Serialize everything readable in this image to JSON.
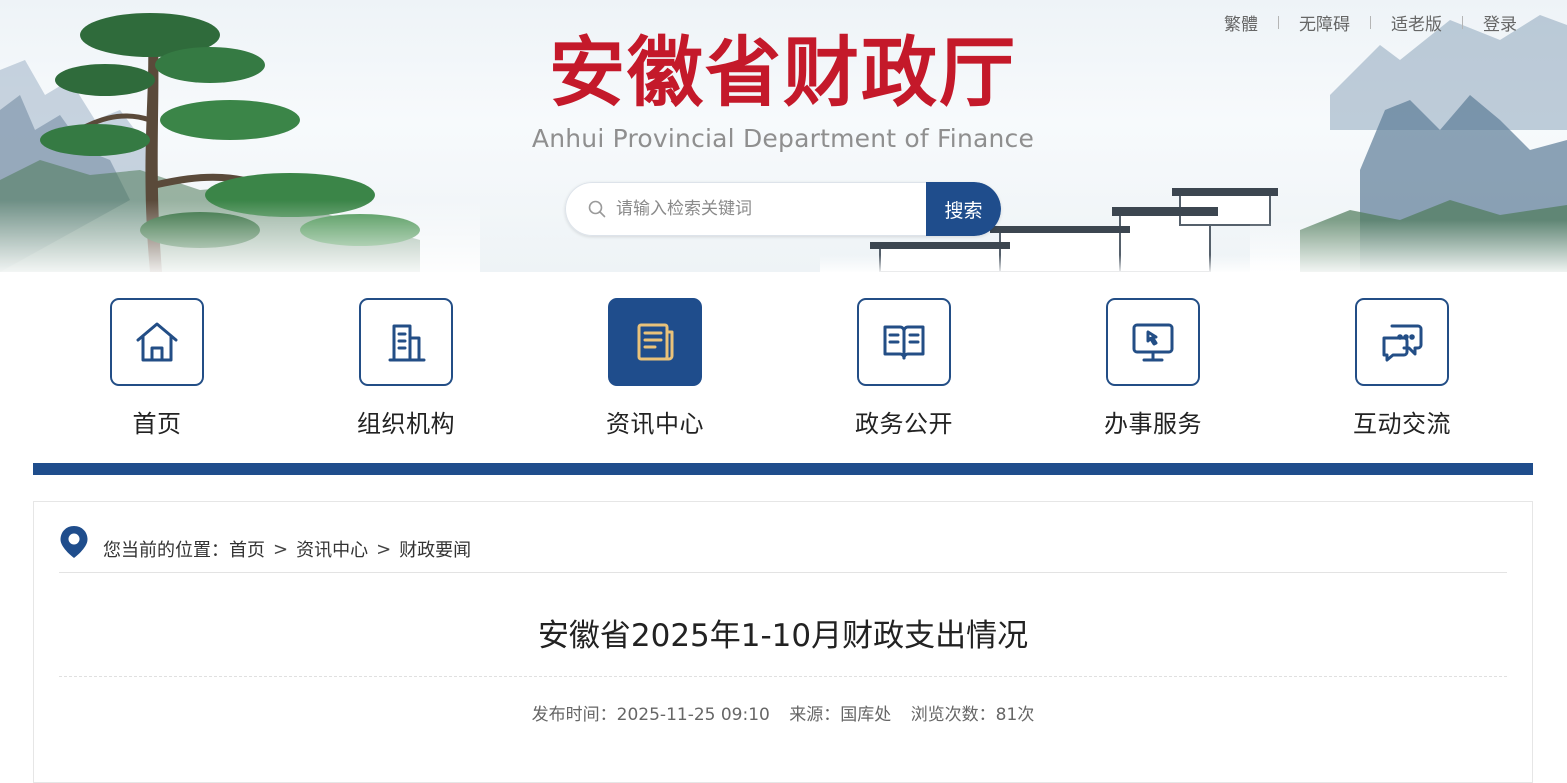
{
  "header": {
    "top_links": [
      "繁體",
      "无障碍",
      "适老版",
      "登录"
    ],
    "site_title": "安徽省财政厅",
    "site_subtitle": "Anhui Provincial Department of Finance",
    "search": {
      "placeholder": "请输入检索关键词",
      "value": "",
      "button_label": "搜索"
    }
  },
  "nav": {
    "items": [
      {
        "label": "首页",
        "icon": "home-icon"
      },
      {
        "label": "组织机构",
        "icon": "building-icon"
      },
      {
        "label": "资讯中心",
        "icon": "news-icon",
        "active": true
      },
      {
        "label": "政务公开",
        "icon": "open-book-icon"
      },
      {
        "label": "办事服务",
        "icon": "monitor-cursor-icon"
      },
      {
        "label": "互动交流",
        "icon": "chat-bubbles-icon"
      }
    ]
  },
  "breadcrumb": {
    "prefix": "您当前的位置：",
    "items": [
      "首页",
      "资讯中心",
      "财政要闻"
    ],
    "separator": ">"
  },
  "article": {
    "title": "安徽省2025年1-10月财政支出情况",
    "meta": {
      "publish_time": "发布时间：2025-11-25 09:10",
      "source": "来源：国库处",
      "views": "浏览次数：81次"
    }
  },
  "colors": {
    "brand_blue": "#1f4d8c",
    "title_red": "#c4192a",
    "nav_icon_active_accent": "#e9c27a"
  }
}
